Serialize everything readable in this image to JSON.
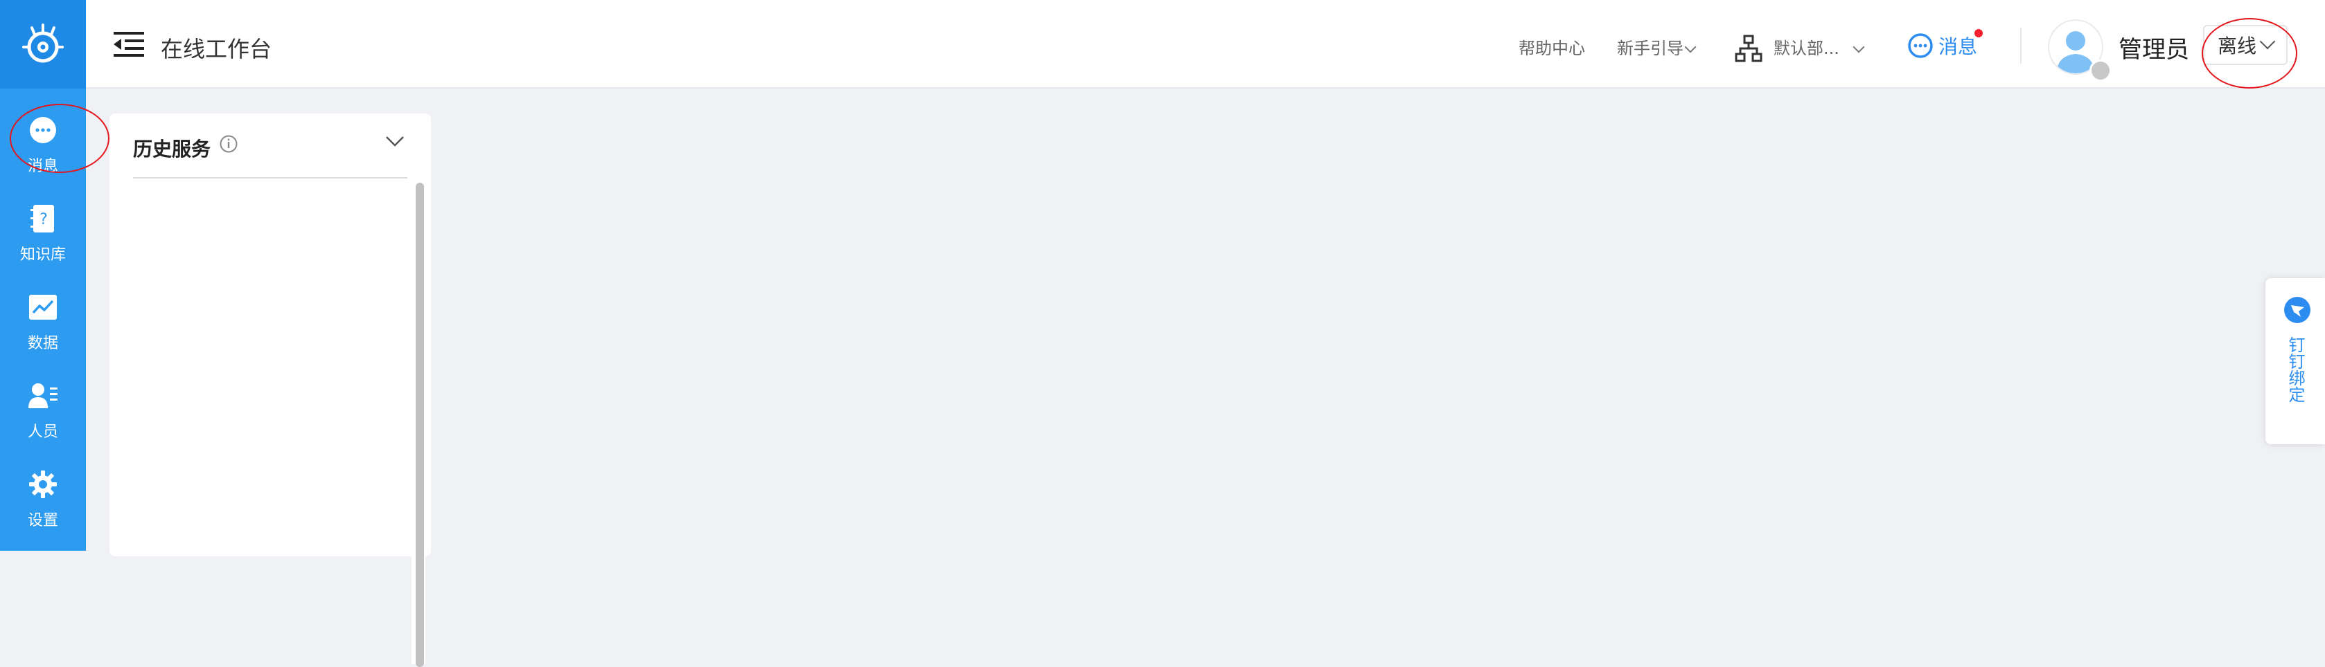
{
  "sidebar": {
    "items": [
      {
        "label": "消息",
        "icon": "chat-bubble-icon"
      },
      {
        "label": "知识库",
        "icon": "book-question-icon"
      },
      {
        "label": "数据",
        "icon": "chart-icon"
      },
      {
        "label": "人员",
        "icon": "person-list-icon"
      },
      {
        "label": "设置",
        "icon": "gear-icon"
      }
    ]
  },
  "header": {
    "title": "在线工作台",
    "help": "帮助中心",
    "guide": "新手引导",
    "department": "默认部...",
    "messages": "消息",
    "username": "管理员",
    "status": "离线"
  },
  "panel": {
    "title": "历史服务"
  },
  "floating": {
    "ding_label": "钉钉绑定"
  },
  "colors": {
    "sidebar": "#2d9bf0",
    "accent": "#2d8cf0",
    "annotation": "#e4161b"
  }
}
